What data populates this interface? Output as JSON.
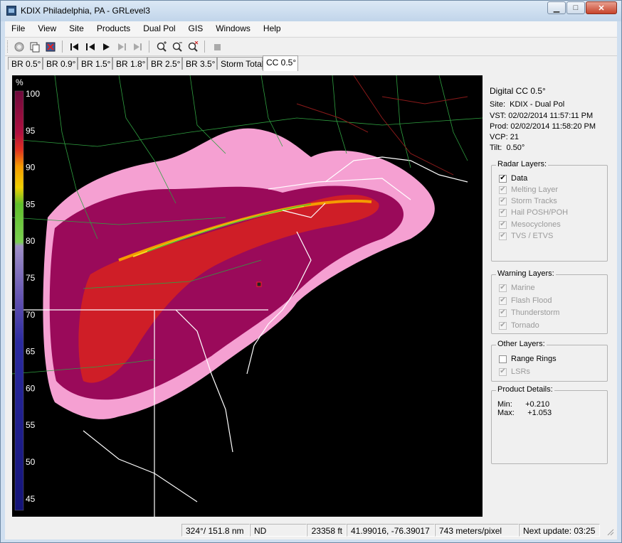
{
  "window": {
    "title": "KDIX Philadelphia, PA - GRLevel3"
  },
  "menu": [
    "File",
    "View",
    "Site",
    "Products",
    "Dual Pol",
    "GIS",
    "Windows",
    "Help"
  ],
  "tabs": [
    {
      "label": "BR 0.5°",
      "active": false
    },
    {
      "label": "BR 0.9°",
      "active": false
    },
    {
      "label": "BR 1.5°",
      "active": false
    },
    {
      "label": "BR 1.8°",
      "active": false
    },
    {
      "label": "BR 2.5°",
      "active": false
    },
    {
      "label": "BR 3.5°",
      "active": false
    },
    {
      "label": "Storm Total",
      "active": false
    },
    {
      "label": "CC 0.5°",
      "active": true
    }
  ],
  "legend": {
    "unit": "%",
    "ticks": [
      "100",
      "95",
      "90",
      "85",
      "80",
      "75",
      "70",
      "65",
      "60",
      "55",
      "50",
      "45"
    ],
    "colors": {
      "high": "#6e0a3c",
      "orange": "#f59b00",
      "green": "#5fbf2a",
      "lavender": "#a090c8",
      "blue": "#1e1e96"
    }
  },
  "product": {
    "name": "Digital CC 0.5°",
    "site_label": "Site:",
    "site_value": "KDIX - Dual Pol",
    "vst_label": "VST:",
    "vst_value": "02/02/2014  11:57:11 PM",
    "prod_label": "Prod:",
    "prod_value": "02/02/2014  11:58:20 PM",
    "vcp_label": "VCP:",
    "vcp_value": "21",
    "tilt_label": "Tilt:",
    "tilt_value": "0.50°"
  },
  "radar_layers": {
    "title": "Radar Layers:",
    "items": [
      {
        "label": "Data",
        "checked": true,
        "enabled": true
      },
      {
        "label": "Melting Layer",
        "checked": true,
        "enabled": false
      },
      {
        "label": "Storm Tracks",
        "checked": true,
        "enabled": false
      },
      {
        "label": "Hail POSH/POH",
        "checked": true,
        "enabled": false
      },
      {
        "label": "Mesocyclones",
        "checked": true,
        "enabled": false
      },
      {
        "label": "TVS / ETVS",
        "checked": true,
        "enabled": false
      }
    ]
  },
  "warning_layers": {
    "title": "Warning Layers:",
    "items": [
      {
        "label": "Marine",
        "checked": true,
        "enabled": false
      },
      {
        "label": "Flash Flood",
        "checked": true,
        "enabled": false
      },
      {
        "label": "Thunderstorm",
        "checked": true,
        "enabled": false
      },
      {
        "label": "Tornado",
        "checked": true,
        "enabled": false
      }
    ]
  },
  "other_layers": {
    "title": "Other Layers:",
    "items": [
      {
        "label": "Range Rings",
        "checked": false,
        "enabled": true
      },
      {
        "label": "LSRs",
        "checked": true,
        "enabled": false
      }
    ]
  },
  "product_details": {
    "title": "Product Details:",
    "min_label": "Min:",
    "min_value": "+0.210",
    "max_label": "Max:",
    "max_value": "+1.053"
  },
  "status": {
    "bearing": "324°/ 151.8 nm",
    "value": "ND",
    "height": "23358 ft",
    "coords": "41.99016, -76.39017",
    "scale": "743 meters/pixel",
    "next_update": "Next update: 03:25"
  }
}
